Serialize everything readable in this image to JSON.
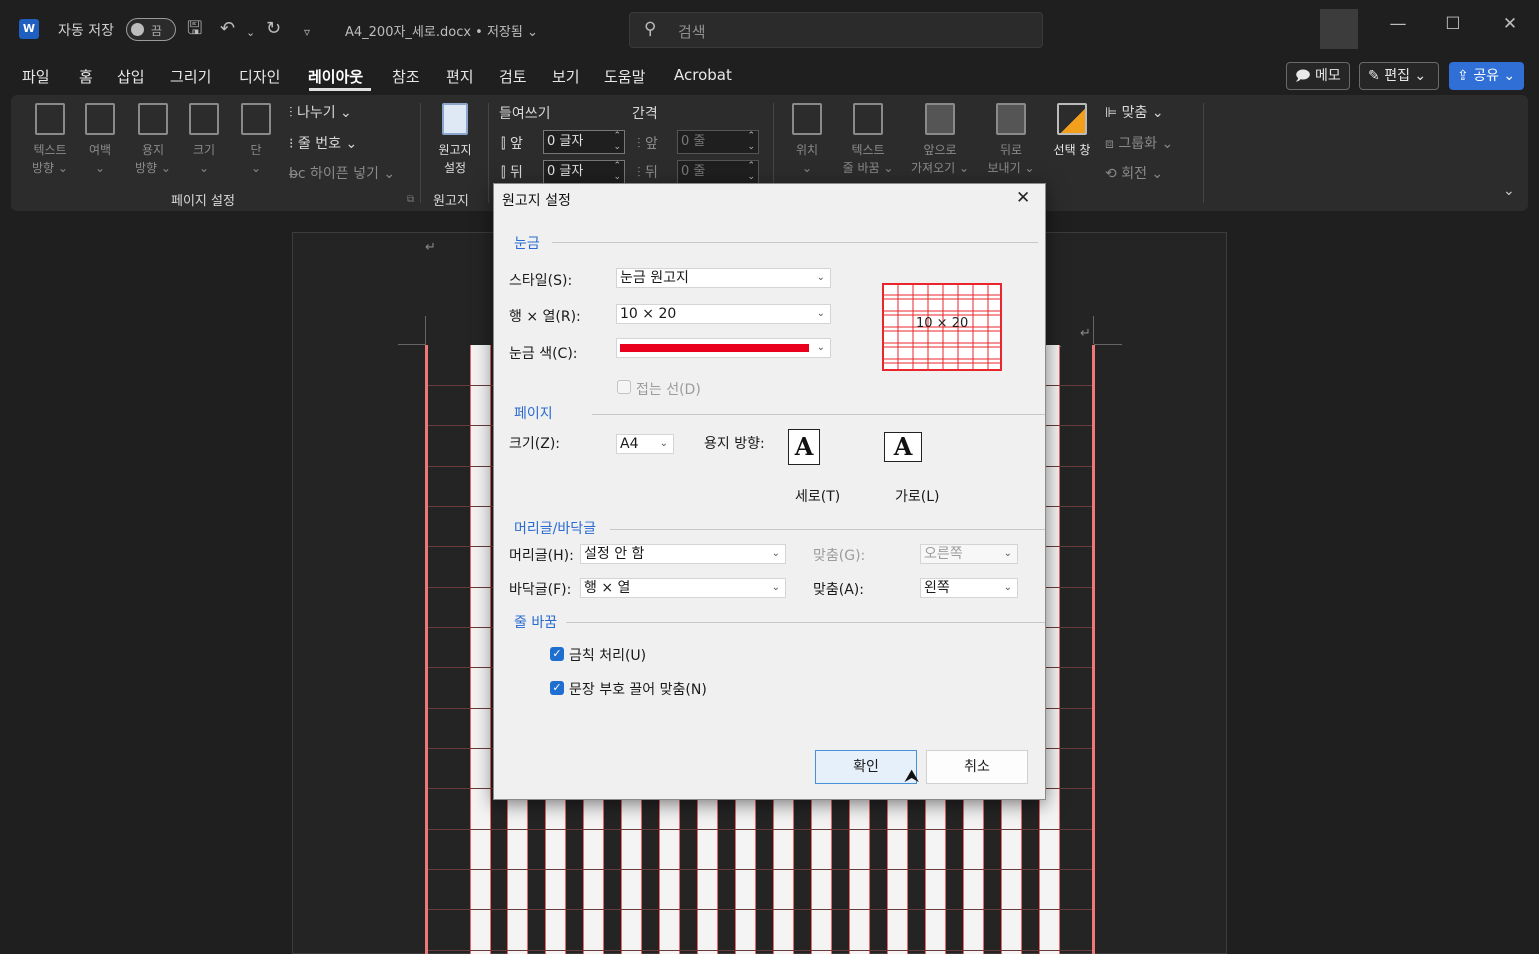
{
  "titlebar": {
    "app_icon_letter": "W",
    "autosave_label": "자동 저장",
    "autosave_state": "끔",
    "doc_title": "A4_200자_세로.docx • 저장됨 ⌄",
    "search_placeholder": "검색"
  },
  "tabs": [
    "파일",
    "홈",
    "삽입",
    "그리기",
    "디자인",
    "레이아웃",
    "참조",
    "편지",
    "검토",
    "보기",
    "도움말",
    "Acrobat"
  ],
  "active_tab": "레이아웃",
  "right_buttons": {
    "memo": "메모",
    "edit": "편집 ⌄",
    "share": "공유 ⌄"
  },
  "ribbon": {
    "text_direction": "텍스트\n방향 ⌄",
    "margins": "여백\n⌄",
    "orientation": "용지\n방향 ⌄",
    "size": "크기\n⌄",
    "columns": "단\n⌄",
    "breaks": "나누기 ⌄",
    "line_numbers": "줄 번호 ⌄",
    "hyphenation": "하이픈 넣기 ⌄",
    "group_page_setup": "페이지 설정",
    "manuscript_btn": "원고지\n설정",
    "group_manuscript": "원고지",
    "indent_label": "들여쓰기",
    "spacing_label": "간격",
    "indent_before_label": "앞",
    "indent_before_value": "0 글자",
    "indent_after_label": "뒤",
    "indent_after_value": "0 글자",
    "spacing_before_label": "앞",
    "spacing_before_value": "0 줄",
    "spacing_after_label": "뒤",
    "spacing_after_value": "0 줄",
    "position": "위치\n⌄",
    "wrap_text": "텍스트\n줄 바꿈 ⌄",
    "bring_forward": "앞으로\n가져오기 ⌄",
    "send_backward": "뒤로\n보내기 ⌄",
    "selection_pane": "선택 창",
    "align": "맞춤 ⌄",
    "group": "그룹화 ⌄",
    "rotate": "회전 ⌄"
  },
  "dialog": {
    "title": "원고지 설정",
    "section_grid": "눈금",
    "style_label": "스타일(S):",
    "style_value": "눈금 원고지",
    "rowcol_label": "행 × 열(R):",
    "rowcol_value": "10 × 20",
    "color_label": "눈금 색(C):",
    "grid_color": "#e8001c",
    "fold_line_label": "접는 선(D)",
    "preview_text": "10 × 20",
    "section_page": "페이지",
    "size_label": "크기(Z):",
    "size_value": "A4",
    "orientation_label": "용지 방향:",
    "portrait_label": "세로(T)",
    "landscape_label": "가로(L)",
    "orient_glyph": "A",
    "section_header_footer": "머리글/바닥글",
    "header_label": "머리글(H):",
    "header_value": "설정 안 함",
    "header_align_label": "맞춤(G):",
    "header_align_value": "오른쪽",
    "footer_label": "바닥글(F):",
    "footer_value": "행 × 열",
    "footer_align_label": "맞춤(A):",
    "footer_align_value": "왼쪽",
    "section_line_break": "줄 바꿈",
    "kinsoku_label": "금칙 처리(U)",
    "punct_label": "문장 부호 끌어 맞춤(N)",
    "ok_label": "확인",
    "cancel_label": "취소"
  }
}
